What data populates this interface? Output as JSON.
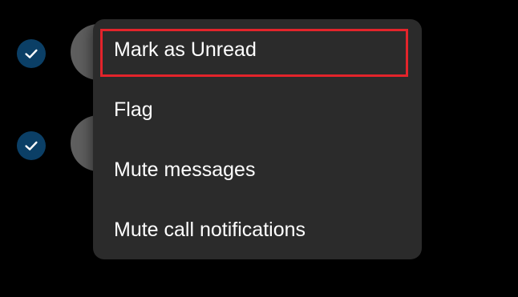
{
  "background": {
    "rows": [
      {
        "selected": true
      },
      {
        "selected": true
      }
    ]
  },
  "context_menu": {
    "items": [
      {
        "label": "Mark as Unread",
        "highlighted": true
      },
      {
        "label": "Flag"
      },
      {
        "label": "Mute messages"
      },
      {
        "label": "Mute call notifications"
      }
    ]
  },
  "colors": {
    "menu_background": "#2b2b2b",
    "highlight_border": "#e3242b",
    "check_fill": "#0b3f66",
    "text": "#ffffff"
  }
}
